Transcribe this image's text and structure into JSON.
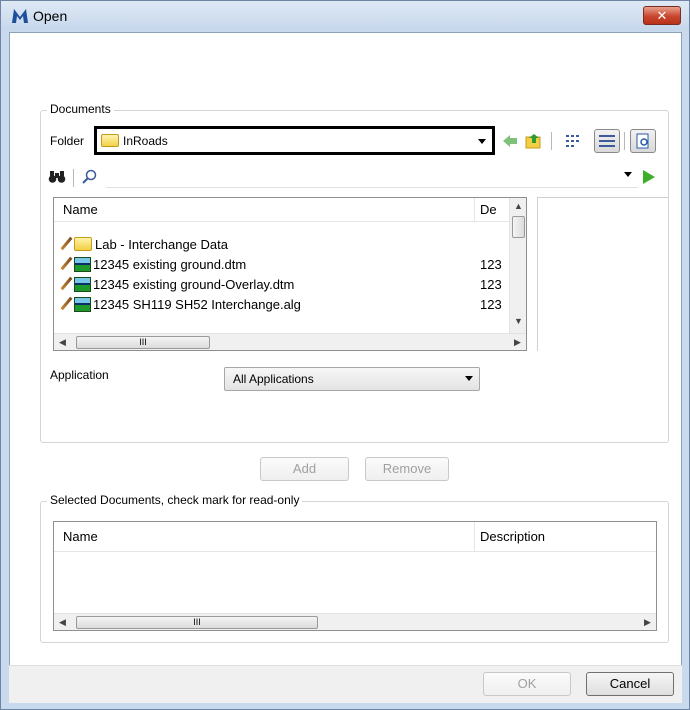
{
  "window": {
    "title": "Open",
    "close_glyph": "✕"
  },
  "documents": {
    "group_label": "Documents",
    "folder_label": "Folder",
    "folder_value": "InRoads",
    "toolbar_icons": [
      "back-arrow-icon",
      "up-folder-icon",
      "list-view-icon",
      "details-view-icon",
      "preview-icon"
    ],
    "filter_icons": [
      "binoculars-icon",
      "search-icon",
      "go-arrow-icon"
    ],
    "filter_value": "",
    "columns": [
      "Name",
      "De"
    ],
    "files": [
      {
        "type": "folder",
        "name": "Lab - Interchange Data",
        "description": ""
      },
      {
        "type": "dtm",
        "name": "12345 existing ground.dtm",
        "description": "123"
      },
      {
        "type": "dtm",
        "name": "12345 existing ground-Overlay.dtm",
        "description": "123"
      },
      {
        "type": "dtm",
        "name": "12345 SH119 SH52 Interchange.alg",
        "description": "123"
      }
    ],
    "application_label": "Application",
    "application_value": "All Applications"
  },
  "actions": {
    "add_label": "Add",
    "remove_label": "Remove"
  },
  "selected": {
    "group_label": "Selected Documents, check mark for read-only",
    "columns": [
      "Name",
      "Description"
    ],
    "rows": []
  },
  "footer": {
    "ok_label": "OK",
    "cancel_label": "Cancel"
  },
  "scroll_glyph": "III",
  "colors": {
    "accent_green": "#3fae2a",
    "close_red": "#c8462f"
  }
}
